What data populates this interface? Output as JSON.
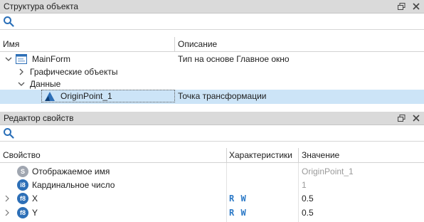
{
  "structure_panel": {
    "title": "Структура объекта",
    "search_placeholder": "",
    "columns": {
      "name": "Имя",
      "description": "Описание"
    },
    "rows": [
      {
        "name": "MainForm",
        "description": "Тип на основе Главное окно",
        "expanded": true
      },
      {
        "name": "Графические объекты",
        "description": "",
        "expanded": false
      },
      {
        "name": "Данные",
        "description": "",
        "expanded": true
      },
      {
        "name": "OriginPoint_1",
        "description": "Точка трансформации",
        "selected": true
      }
    ]
  },
  "properties_panel": {
    "title": "Редактор свойств",
    "search_placeholder": "",
    "columns": {
      "property": "Свойство",
      "characteristics": "Характеристики",
      "value": "Значение"
    },
    "rows": [
      {
        "badge": "S",
        "badge_color": "#a0a6b0",
        "name": "Отображаемое имя",
        "characteristics": "",
        "value": "OriginPoint_1",
        "value_muted": true
      },
      {
        "badge": "i8",
        "badge_color": "#2d6fb7",
        "name": "Кардинальное число",
        "characteristics": "",
        "value": "1",
        "value_muted": true
      },
      {
        "badge": "f8",
        "badge_color": "#2d6fb7",
        "name": "X",
        "characteristics": "R W",
        "value": "0.5",
        "value_muted": false
      },
      {
        "badge": "f8",
        "badge_color": "#2d6fb7",
        "name": "Y",
        "characteristics": "R W",
        "value": "0.5",
        "value_muted": false
      }
    ]
  },
  "colors": {
    "selection": "#cce4f7",
    "title_bar": "#dadada",
    "accent": "#2a78c6"
  }
}
